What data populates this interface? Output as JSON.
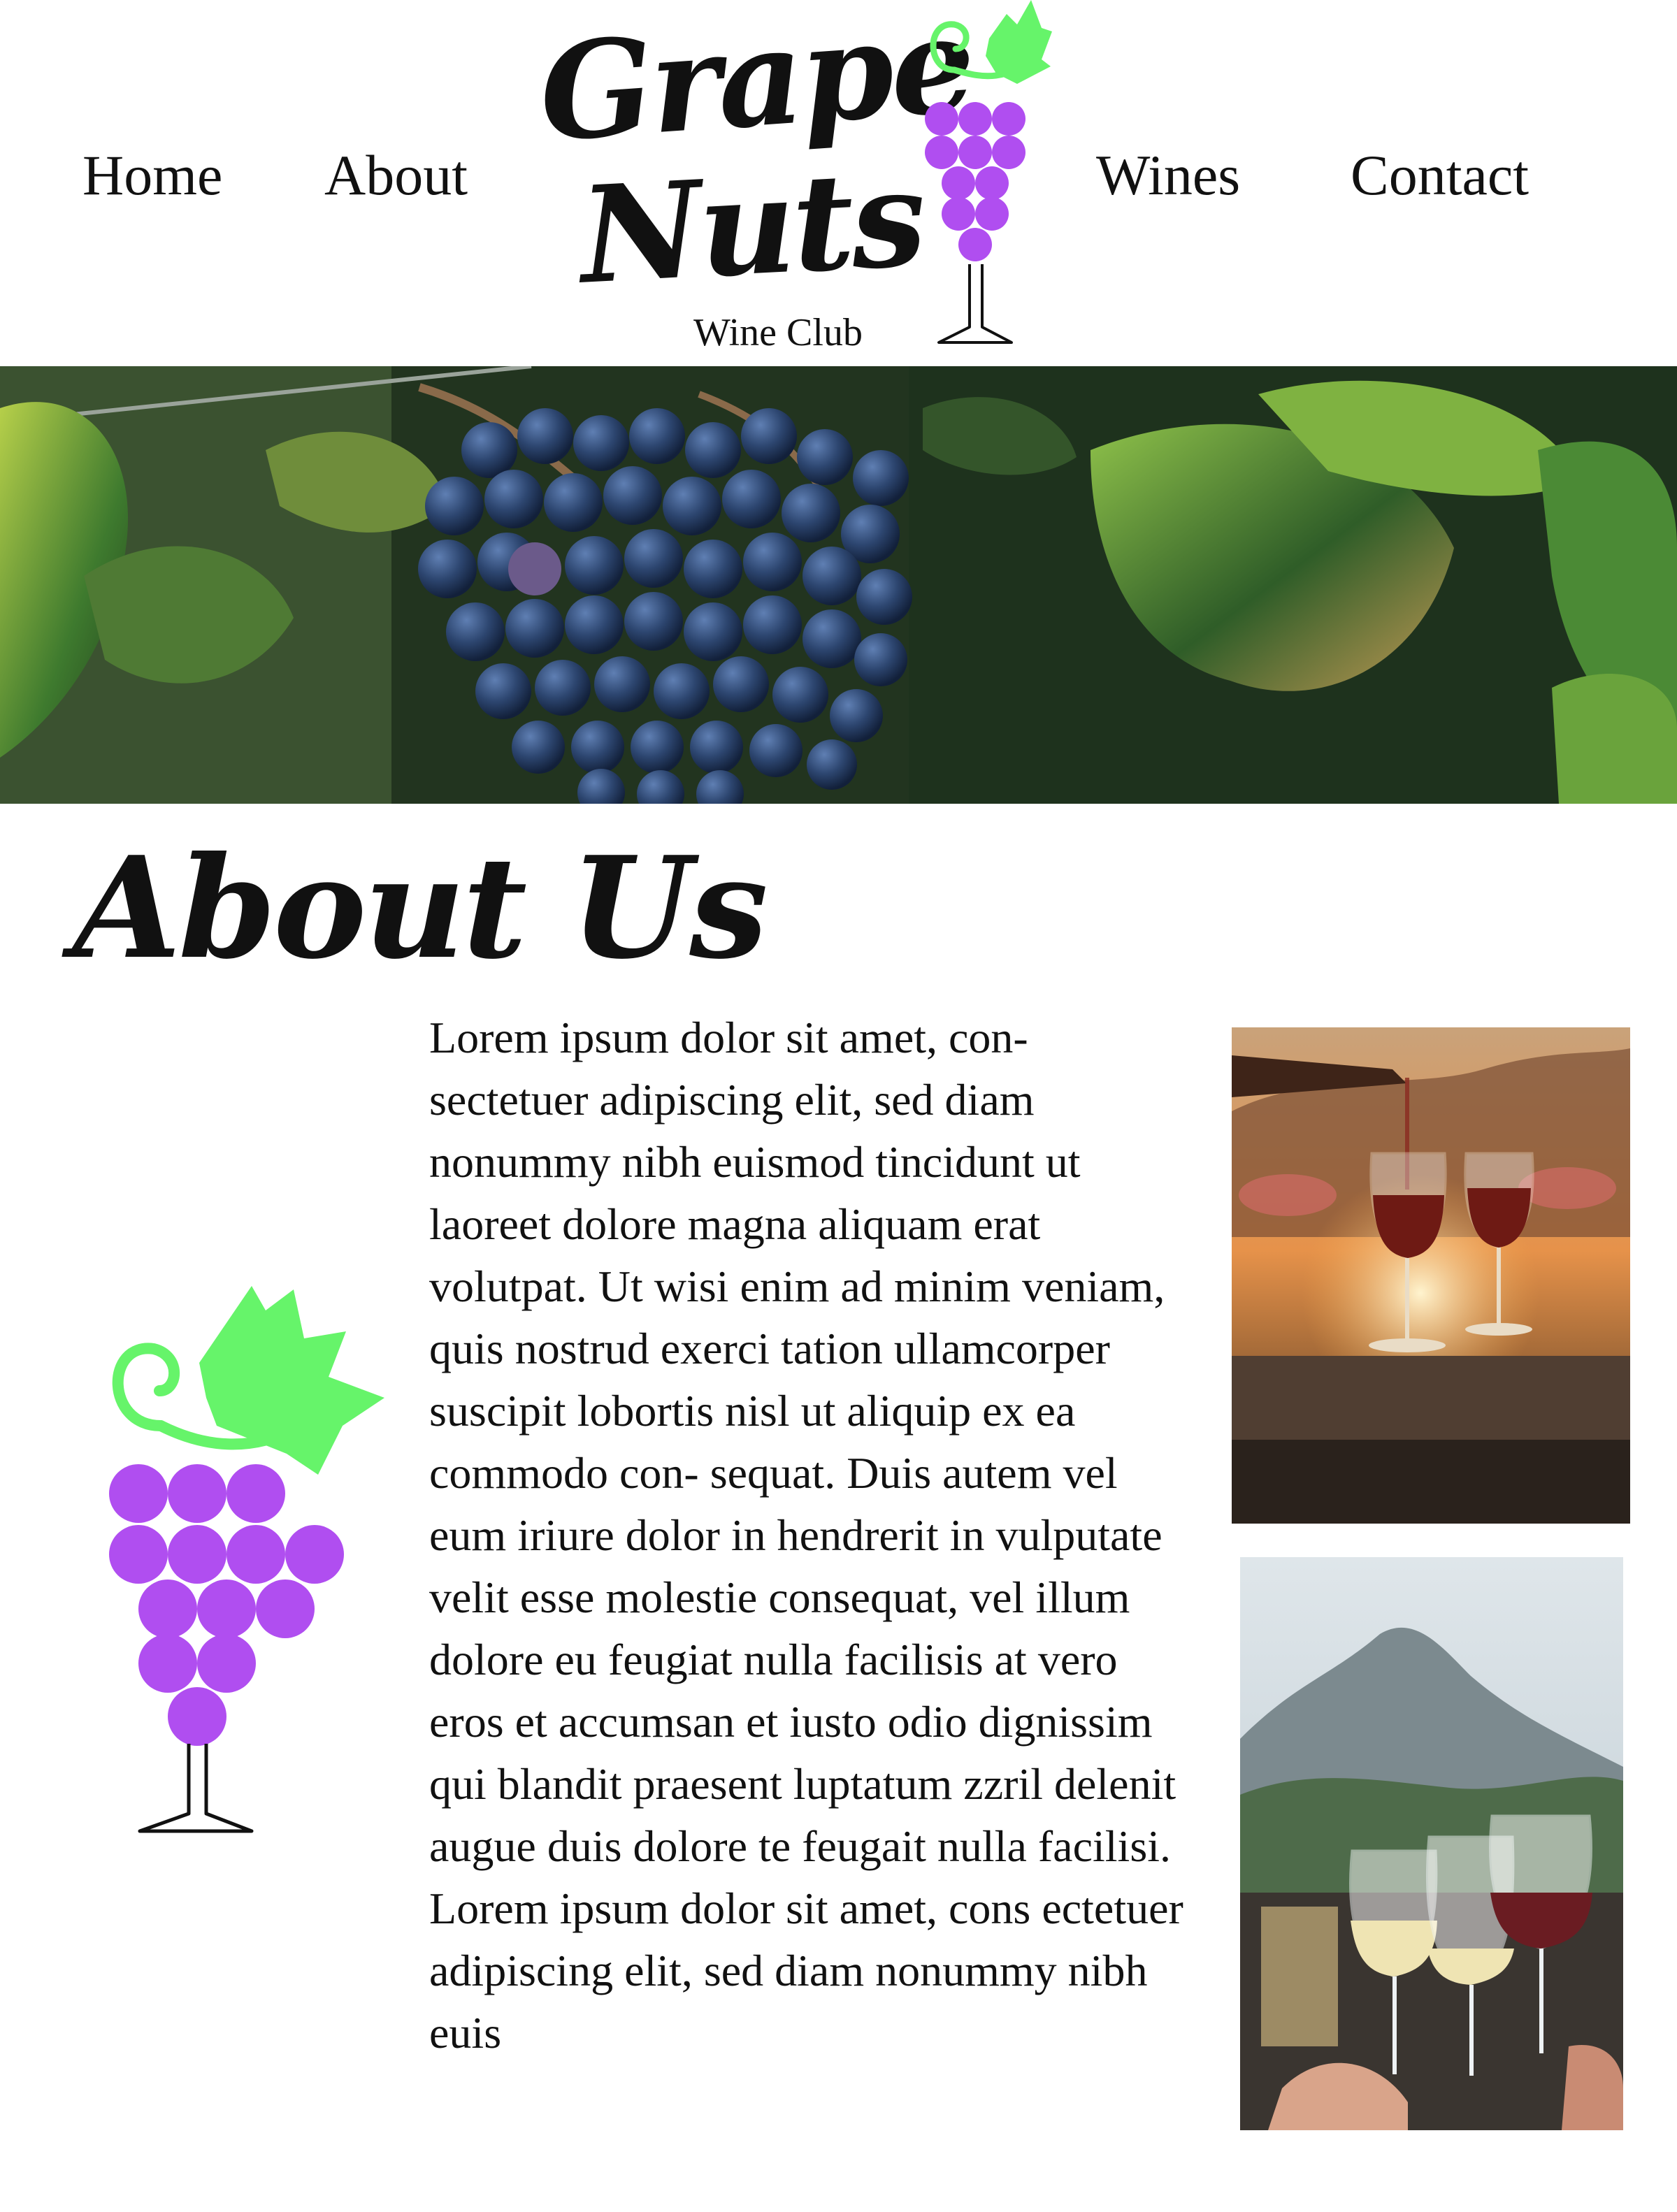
{
  "nav": {
    "home": "Home",
    "about": "About",
    "wines": "Wines",
    "contact": "Contact"
  },
  "logo": {
    "line1": "Grape",
    "line2": "Nuts",
    "subtitle": "Wine Club"
  },
  "about": {
    "title": "About Us",
    "body": "Lorem ipsum dolor sit amet, con- sectetuer adipiscing elit, sed diam nonummy nibh euismod tincidunt ut laoreet dolore magna aliquam erat volutpat. Ut wisi enim ad minim veniam, quis nostrud exerci tation ullamcorper suscipit lobortis nisl ut aliquip ex ea commodo con- sequat. Duis autem vel eum iriure dolor in hendrerit in vulputate velit esse molestie consequat, vel illum dolore eu feugiat nulla facilisis at vero eros et accumsan et iusto odio dignissim qui blandit praesent luptatum zzril delenit augue duis dolore te feugait nulla facilisi. Lorem ipsum dolor sit amet, cons ectetuer adipiscing elit, sed diam nonummy nibh euis"
  },
  "colors": {
    "grape_purple": "#b04ef0",
    "leaf_green": "#66f46a",
    "text": "#111111",
    "background": "#ffffff"
  },
  "icons": [
    "grape-glass-icon"
  ]
}
